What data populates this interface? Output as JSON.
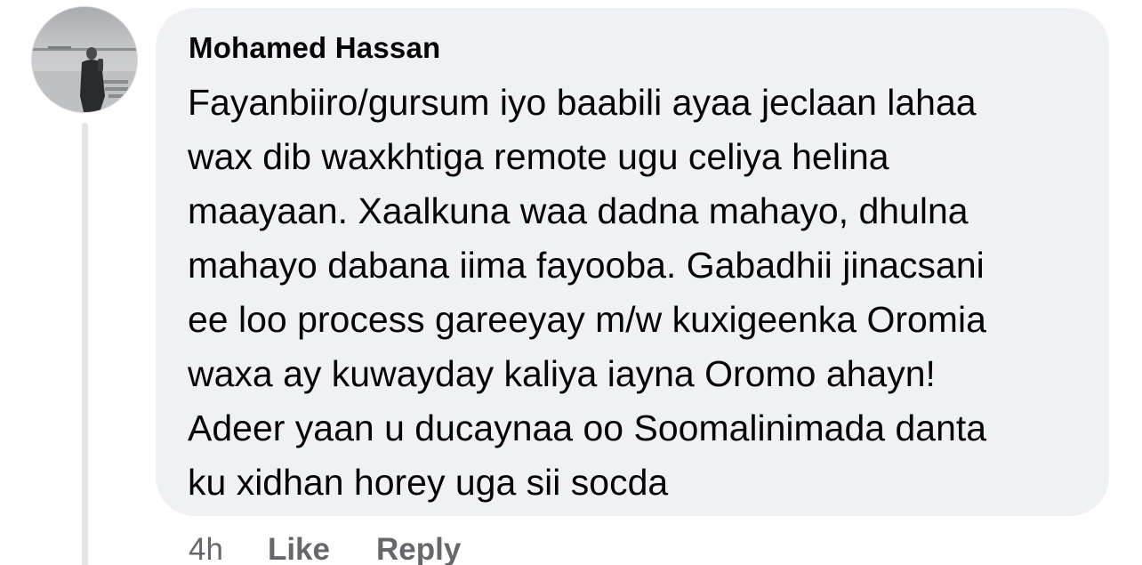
{
  "comment": {
    "author": "Mohamed Hassan",
    "lines": [
      "Fayanbiiro/gursum iyo baabili ayaa jeclaan lahaa",
      "wax dib waxkhtiga remote ugu celiya helina",
      "maayaan. Xaalkuna waa dadna mahayo, dhulna",
      "mahayo dabana iima fayooba. Gabadhii jinacsani",
      "ee loo process gareeyay m/w kuxigeenka Oromia",
      "waxa ay kuwayday kaliya iayna Oromo ahayn!",
      "Adeer yaan u ducaynaa oo Soomalinimada danta",
      "ku xidhan horey uga sii socda"
    ],
    "time": "4h",
    "like_label": "Like",
    "reply_label": "Reply"
  },
  "colors": {
    "bubble": "#f0f1f5",
    "text": "#050505",
    "meta": "#65676b",
    "thread_line": "#e4e5e9"
  }
}
